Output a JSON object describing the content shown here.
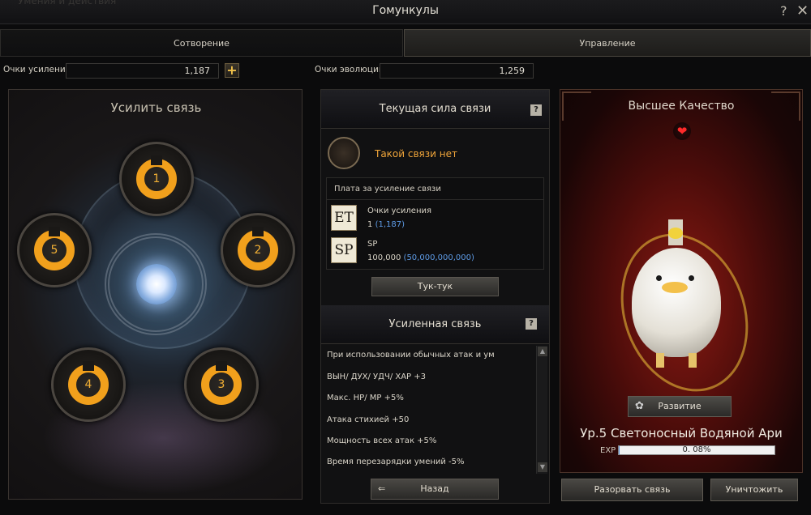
{
  "window": {
    "title": "Гомункулы",
    "ghost_text": "Умения и действия",
    "help_label": "?",
    "close_label": "✕"
  },
  "tabs": [
    {
      "label": "Сотворение",
      "active": false
    },
    {
      "label": "Управление",
      "active": true
    }
  ],
  "points": {
    "enhance_label": "Очки усиления",
    "enhance_value": "1,187",
    "add_label": "+",
    "evolution_label": "Очки эволюции",
    "evolution_value": "1,259"
  },
  "left_panel": {
    "title": "Усилить связь",
    "nodes": [
      "1",
      "2",
      "3",
      "4",
      "5"
    ]
  },
  "middle_panel": {
    "current_title": "Текущая сила связи",
    "help": "?",
    "no_link": "Такой связи нет",
    "cost_title": "Плата за усиление связи",
    "costs": [
      {
        "icon_text": "ET",
        "icon": "enhance-points-icon",
        "name": "Очки усиления",
        "amount": "1",
        "available": "(1,187)"
      },
      {
        "icon_text": "SP",
        "icon": "sp-icon",
        "name": "SP",
        "amount": "100,000",
        "available": "(50,000,000,000)"
      }
    ],
    "tap_button": "Тук-тук",
    "enhanced_title": "Усиленная связь",
    "stats": [
      "При использовании обычных атак и ум",
      "ВЫН/ ДУХ/ УДЧ/ ХАР +3",
      "Макс. HP/ MP +5%",
      "Атака стихией +50",
      "Мощность всех атак +5%",
      "Время перезарядки умений -5%"
    ],
    "back_button": "Назад",
    "back_arrow": "⇐"
  },
  "right_panel": {
    "quality": "Высшее Качество",
    "heart": "❤",
    "evolve_button": "Развитие",
    "evolve_icon": "✿",
    "pet_name": "Ур.5 Светоносный Водяной Ари",
    "exp_label": "EXP",
    "exp_value": "0. 08%",
    "exp_fraction": 0.0008,
    "break_button": "Разорвать связь",
    "destroy_button": "Уничтожить"
  },
  "colors": {
    "accent_orange": "#f1a01c",
    "link_blue": "#5e9be6",
    "warning_text": "#f0a53a"
  }
}
